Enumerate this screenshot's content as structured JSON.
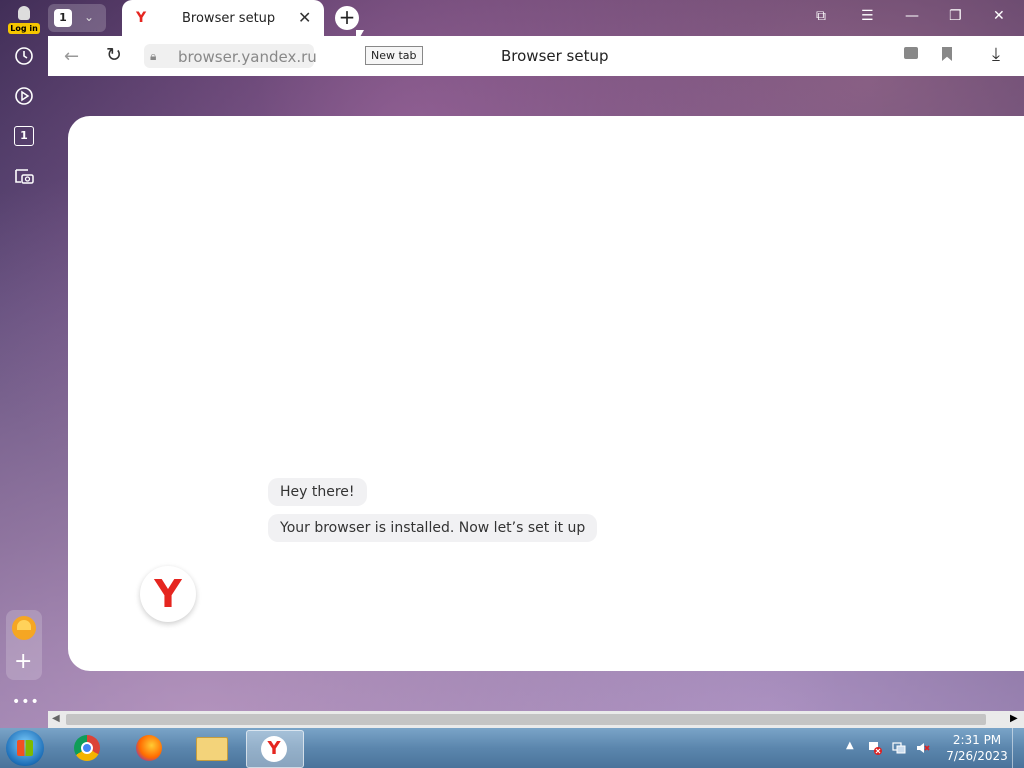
{
  "sidebar": {
    "login_label": "Log in",
    "items": [
      {
        "icon": "history-icon"
      },
      {
        "icon": "play-icon"
      },
      {
        "icon": "tab-count-icon",
        "label": "1"
      },
      {
        "icon": "screenshot-icon"
      }
    ],
    "more_label": "•••"
  },
  "tabstrip": {
    "tab_count": "1",
    "tabs": [
      {
        "title": "Browser setup",
        "favicon": "Y"
      }
    ],
    "new_tab_tooltip": "New tab"
  },
  "window_controls": {
    "bookmarks": "⧉",
    "menu": "☰",
    "minimize": "—",
    "restore": "❐",
    "close": "✕"
  },
  "addressbar": {
    "url": "browser.yandex.ru",
    "page_title": "Browser setup"
  },
  "main": {
    "greeting": "Hey there!",
    "message": "Your browser is installed. Now let’s set it up",
    "logo_letter": "Y"
  },
  "taskbar": {
    "apps": [
      {
        "name": "chrome"
      },
      {
        "name": "firefox"
      },
      {
        "name": "file-explorer"
      },
      {
        "name": "yandex-browser",
        "active": true
      }
    ],
    "time": "2:31 PM",
    "date": "7/26/2023"
  },
  "colors": {
    "yandex_red": "#e52620",
    "login_badge": "#f6c700"
  }
}
